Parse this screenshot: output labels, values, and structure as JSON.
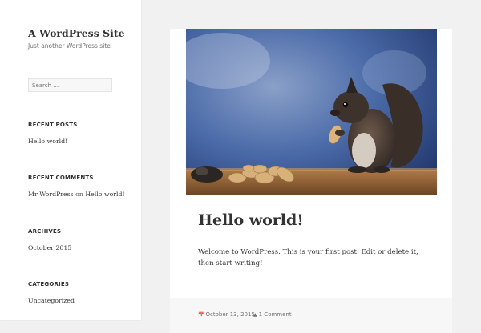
{
  "site": {
    "title": "A WordPress Site",
    "description": "Just another WordPress site"
  },
  "search": {
    "placeholder": "Search …"
  },
  "widgets": {
    "recent_posts": {
      "title": "RECENT POSTS",
      "items": [
        "Hello world!"
      ]
    },
    "recent_comments": {
      "title": "RECENT COMMENTS",
      "items": [
        {
          "author": "Mr WordPress",
          "joiner": "on",
          "post": "Hello world!"
        }
      ]
    },
    "archives": {
      "title": "ARCHIVES",
      "items": [
        "October 2015"
      ]
    },
    "categories": {
      "title": "CATEGORIES",
      "items": [
        "Uncategorized"
      ]
    }
  },
  "post": {
    "image_icon": "squirrel-photo",
    "title": "Hello world!",
    "content": "Welcome to WordPress. This is your first post. Edit or delete it, then start writing!",
    "date": "October 13, 2015",
    "comments": "1 Comment",
    "date_icon": "calendar-icon",
    "comment_icon": "comment-icon"
  },
  "colors": {
    "background": "#f1f1f1",
    "sidebar": "#ffffff",
    "text": "#333333",
    "muted": "#707070",
    "footer": "#f7f7f7"
  }
}
